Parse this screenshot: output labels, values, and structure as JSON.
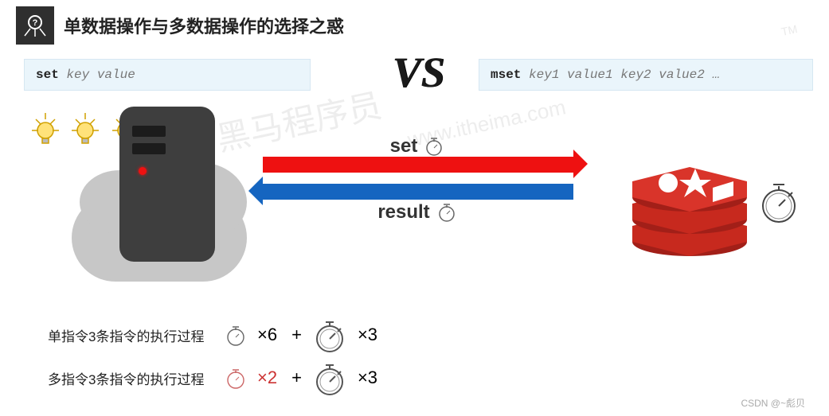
{
  "header": {
    "title": "单数据操作与多数据操作的选择之惑"
  },
  "code_left": {
    "cmd": "set",
    "args": "key value"
  },
  "vs": "VS",
  "code_right": {
    "cmd": "mset",
    "args": "key1 value1 key2 value2 …"
  },
  "arrows": {
    "set_label": "set",
    "result_label": "result"
  },
  "formula1": {
    "label": "单指令3条指令的执行过程",
    "a": "×6",
    "plus": "+",
    "b": "×3"
  },
  "formula2": {
    "label": "多指令3条指令的执行过程",
    "a": "×2",
    "plus": "+",
    "b": "×3"
  },
  "watermark": {
    "main": "黑马程序员",
    "sub": "www.itheima.com",
    "tm": "TM"
  },
  "credit": "CSDN @~彪贝"
}
